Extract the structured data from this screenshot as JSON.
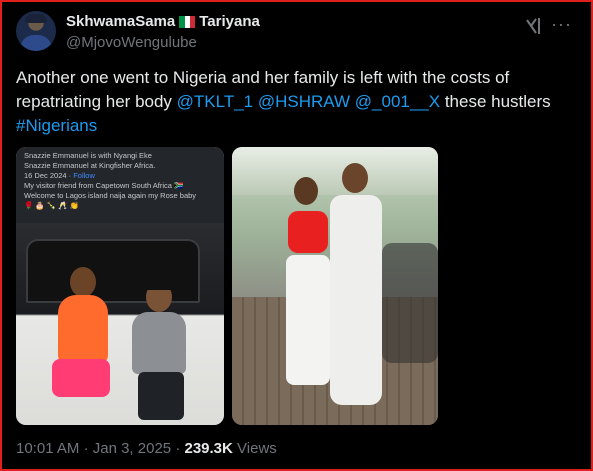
{
  "author": {
    "display_name": "SkhwamaSama",
    "display_name_suffix": "Tariyana",
    "handle": "@MjovoWengulube",
    "flag_colors": [
      "#009246",
      "#ffffff",
      "#ce2b37"
    ]
  },
  "icons": {
    "grok": "grok-icon",
    "more": "more-options-icon"
  },
  "tweet": {
    "text_part1": "Another one went to Nigeria and her family is left with the costs of repatriating her body ",
    "mention1": "@TKLT_1",
    "mention2": "@HSHRAW",
    "mention3": "@_001__X",
    "text_part2": "  these hustlers ",
    "hashtag": "#Nigerians"
  },
  "media": {
    "fb_post": {
      "line1": "Snazzie Emmanuel is with Nyangi Eke",
      "line2": "Snazzie Emmanuel at Kingfisher Africa.",
      "date": "16 Dec 2024 · ",
      "follow": "Follow",
      "line3": "My visitor friend from Capetown South Africa 🇿🇦",
      "line4": "Welcome to Lagos island naija again my Rose baby",
      "emojis": "🌹 🎂 🍾 🥂 👏"
    }
  },
  "footer": {
    "time": "10:01 AM",
    "date": "Jan 3, 2025",
    "views_count": "239.3K",
    "views_label": "Views",
    "separator": "·"
  },
  "colors": {
    "link": "#1d9bf0",
    "border": "#e0201c",
    "background": "#000000"
  }
}
